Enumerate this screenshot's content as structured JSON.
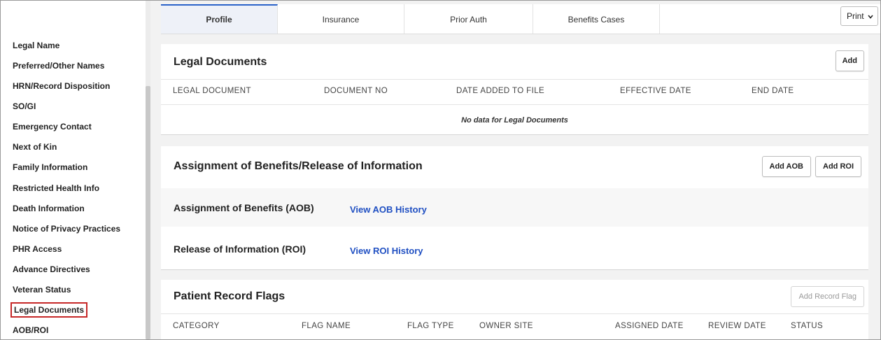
{
  "sidebar": {
    "items": [
      {
        "label": "Legal Name"
      },
      {
        "label": "Preferred/Other Names"
      },
      {
        "label": "HRN/Record Disposition"
      },
      {
        "label": "SO/GI"
      },
      {
        "label": "Emergency Contact"
      },
      {
        "label": "Next of Kin"
      },
      {
        "label": "Family Information"
      },
      {
        "label": "Restricted Health Info"
      },
      {
        "label": "Death Information"
      },
      {
        "label": "Notice of Privacy Practices"
      },
      {
        "label": "PHR Access"
      },
      {
        "label": "Advance Directives"
      },
      {
        "label": "Veteran Status"
      },
      {
        "label": "Legal Documents",
        "active": true
      },
      {
        "label": "AOB/ROI"
      }
    ]
  },
  "tabs": [
    {
      "label": "Profile",
      "active": true
    },
    {
      "label": "Insurance"
    },
    {
      "label": "Prior Auth"
    },
    {
      "label": "Benefits Cases"
    }
  ],
  "print": {
    "label": "Print",
    "icon": "chevron-down-icon"
  },
  "legal_documents": {
    "title": "Legal Documents",
    "add_label": "Add",
    "columns": [
      "LEGAL DOCUMENT",
      "DOCUMENT NO",
      "DATE ADDED TO FILE",
      "EFFECTIVE DATE",
      "END DATE"
    ],
    "empty_message": "No data for Legal Documents"
  },
  "aob_roi": {
    "title": "Assignment of Benefits/Release of Information",
    "add_aob_label": "Add AOB",
    "add_roi_label": "Add ROI",
    "aob_label": "Assignment of Benefits (AOB)",
    "aob_link": "View AOB History",
    "roi_label": "Release of Information (ROI)",
    "roi_link": "View ROI History"
  },
  "record_flags": {
    "title": "Patient Record Flags",
    "add_label": "Add Record Flag",
    "columns": [
      "CATEGORY",
      "FLAG NAME",
      "FLAG TYPE",
      "OWNER SITE",
      "ASSIGNED DATE",
      "REVIEW DATE",
      "STATUS"
    ]
  },
  "colors": {
    "accent": "#2a62c9",
    "link": "#1f4fc2",
    "highlight_border": "#c62828"
  }
}
